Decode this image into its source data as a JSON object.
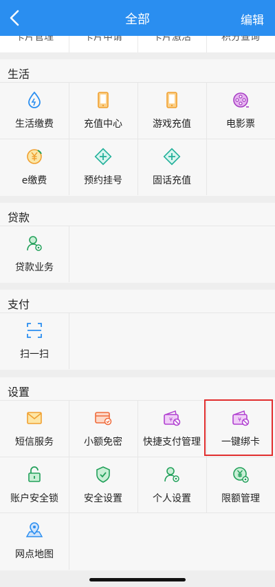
{
  "header": {
    "title": "全部",
    "edit_label": "编辑"
  },
  "top_strip": {
    "labels": [
      "卡片管理",
      "卡片申请",
      "卡片激活",
      "积分查询"
    ]
  },
  "sections": {
    "life": {
      "title": "生活",
      "items": [
        {
          "label": "生活缴费",
          "icon": "water-drop-icon"
        },
        {
          "label": "充值中心",
          "icon": "phone-icon"
        },
        {
          "label": "游戏充值",
          "icon": "phone-icon"
        },
        {
          "label": "电影票",
          "icon": "film-reel-icon"
        },
        {
          "label": "e缴费",
          "icon": "yuan-coin-icon"
        },
        {
          "label": "预约挂号",
          "icon": "medical-cross-icon"
        },
        {
          "label": "固话充值",
          "icon": "medical-cross-icon"
        }
      ]
    },
    "loan": {
      "title": "贷款",
      "items": [
        {
          "label": "贷款业务",
          "icon": "user-gear-icon"
        }
      ]
    },
    "pay": {
      "title": "支付",
      "items": [
        {
          "label": "扫一扫",
          "icon": "scan-icon"
        }
      ]
    },
    "settings": {
      "title": "设置",
      "items": [
        {
          "label": "短信服务",
          "icon": "envelope-icon"
        },
        {
          "label": "小额免密",
          "icon": "card-check-icon"
        },
        {
          "label": "快捷支付管理",
          "icon": "wallet-ban-icon"
        },
        {
          "label": "一键绑卡",
          "icon": "wallet-ban-icon"
        },
        {
          "label": "账户安全锁",
          "icon": "lock-icon"
        },
        {
          "label": "安全设置",
          "icon": "shield-check-icon"
        },
        {
          "label": "个人设置",
          "icon": "user-gear-icon"
        },
        {
          "label": "限额管理",
          "icon": "yuan-gear-icon"
        },
        {
          "label": "网点地图",
          "icon": "map-pin-icon"
        }
      ]
    }
  }
}
